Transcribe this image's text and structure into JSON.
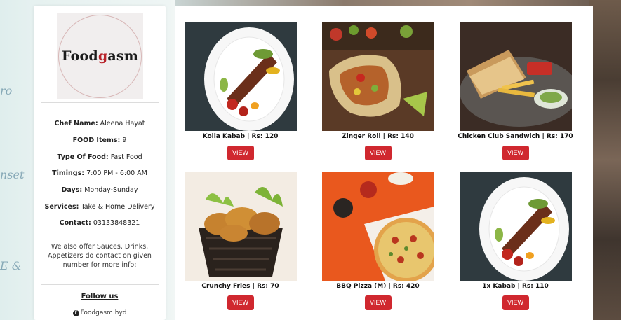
{
  "brand": {
    "logo_text_a": "Food",
    "logo_text_b": "asm",
    "logo_letter": "g"
  },
  "sidebar": {
    "chef_label": "Chef Name:",
    "chef_value": "Aleena Hayat",
    "items_label": "FOOD Items:",
    "items_value": "9",
    "type_label": "Type Of Food:",
    "type_value": "Fast Food",
    "timings_label": "Timings:",
    "timings_value": "7:00 PM - 6:00 AM",
    "days_label": "Days:",
    "days_value": "Monday-Sunday",
    "services_label": "Services:",
    "services_value": "Take & Home Delivery",
    "contact_label": "Contact:",
    "contact_value": "03133848321",
    "note": "We also offer Sauces, Drinks, Appetizers do contact on given number for more info:",
    "follow_label": "Follow us",
    "social_handle": "Foodgasm.hyd"
  },
  "menu": {
    "view_label": "VIEW",
    "items": [
      {
        "title": "Koila Kabab | Rs: 120"
      },
      {
        "title": "Zinger Roll | Rs: 140"
      },
      {
        "title": "Chicken Club Sandwich | Rs: 170"
      },
      {
        "title": "Crunchy Fries | Rs: 70"
      },
      {
        "title": "BBQ Pizza (M) | Rs: 420"
      },
      {
        "title": "1x Kabab | Rs: 110"
      }
    ]
  },
  "colors": {
    "accent": "#d0282f",
    "panel": "#ffffff"
  }
}
